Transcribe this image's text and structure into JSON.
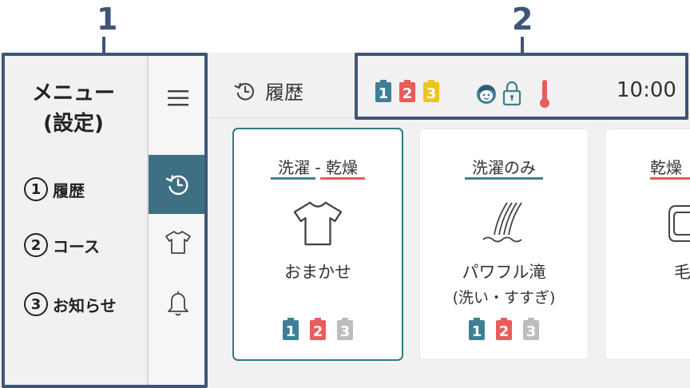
{
  "callouts": {
    "one": "1",
    "two": "2"
  },
  "menu": {
    "title_line1": "メニュー",
    "title_line2": "(設定)",
    "items": [
      {
        "num": "1",
        "label": "履歴"
      },
      {
        "num": "2",
        "label": "コース"
      },
      {
        "num": "3",
        "label": "お知らせ"
      }
    ]
  },
  "sidebar": {
    "buttons": [
      {
        "icon": "hamburger-icon",
        "active": false
      },
      {
        "icon": "history-icon",
        "active": true
      },
      {
        "icon": "shirt-icon",
        "active": false
      },
      {
        "icon": "bell-icon",
        "active": false
      }
    ]
  },
  "header": {
    "title": "履歴",
    "title_icon": "history-icon",
    "time": "10:00",
    "status_badges": [
      {
        "label": "1",
        "color": "#3f7f96"
      },
      {
        "label": "2",
        "color": "#e85c5c"
      },
      {
        "label": "3",
        "color": "#f0c419"
      }
    ],
    "status_icons": [
      "child-face-icon",
      "lock-icon",
      "thermometer-icon"
    ]
  },
  "cards": [
    {
      "category": "洗濯 - 乾燥",
      "category_part1": "洗濯",
      "category_sep": "-",
      "category_part2": "乾燥",
      "icon": "shirt-icon",
      "name_line1": "おまかせ",
      "name_line2": "",
      "selected": true,
      "badges": [
        {
          "label": "1",
          "color": "#3f7f96"
        },
        {
          "label": "2",
          "color": "#e85c5c"
        },
        {
          "label": "3",
          "color": "#bdbdbd"
        }
      ]
    },
    {
      "category": "洗濯のみ",
      "icon": "water-flow-icon",
      "name_line1": "パワフル滝",
      "name_line2": "(洗い・すすぎ)",
      "selected": false,
      "badges": [
        {
          "label": "1",
          "color": "#3f7f96"
        },
        {
          "label": "2",
          "color": "#e85c5c"
        },
        {
          "label": "3",
          "color": "#bdbdbd"
        }
      ]
    },
    {
      "category": "乾燥",
      "icon": "blanket-icon",
      "name_line1": "毛",
      "name_line2": "",
      "selected": false,
      "badges": []
    }
  ],
  "colors": {
    "callout": "#3f5577",
    "active_sidebar": "#3f6f82",
    "wash_underline": "#3f7f96",
    "dry_underline": "#e85c5c",
    "selected_border": "#2f7a80"
  }
}
